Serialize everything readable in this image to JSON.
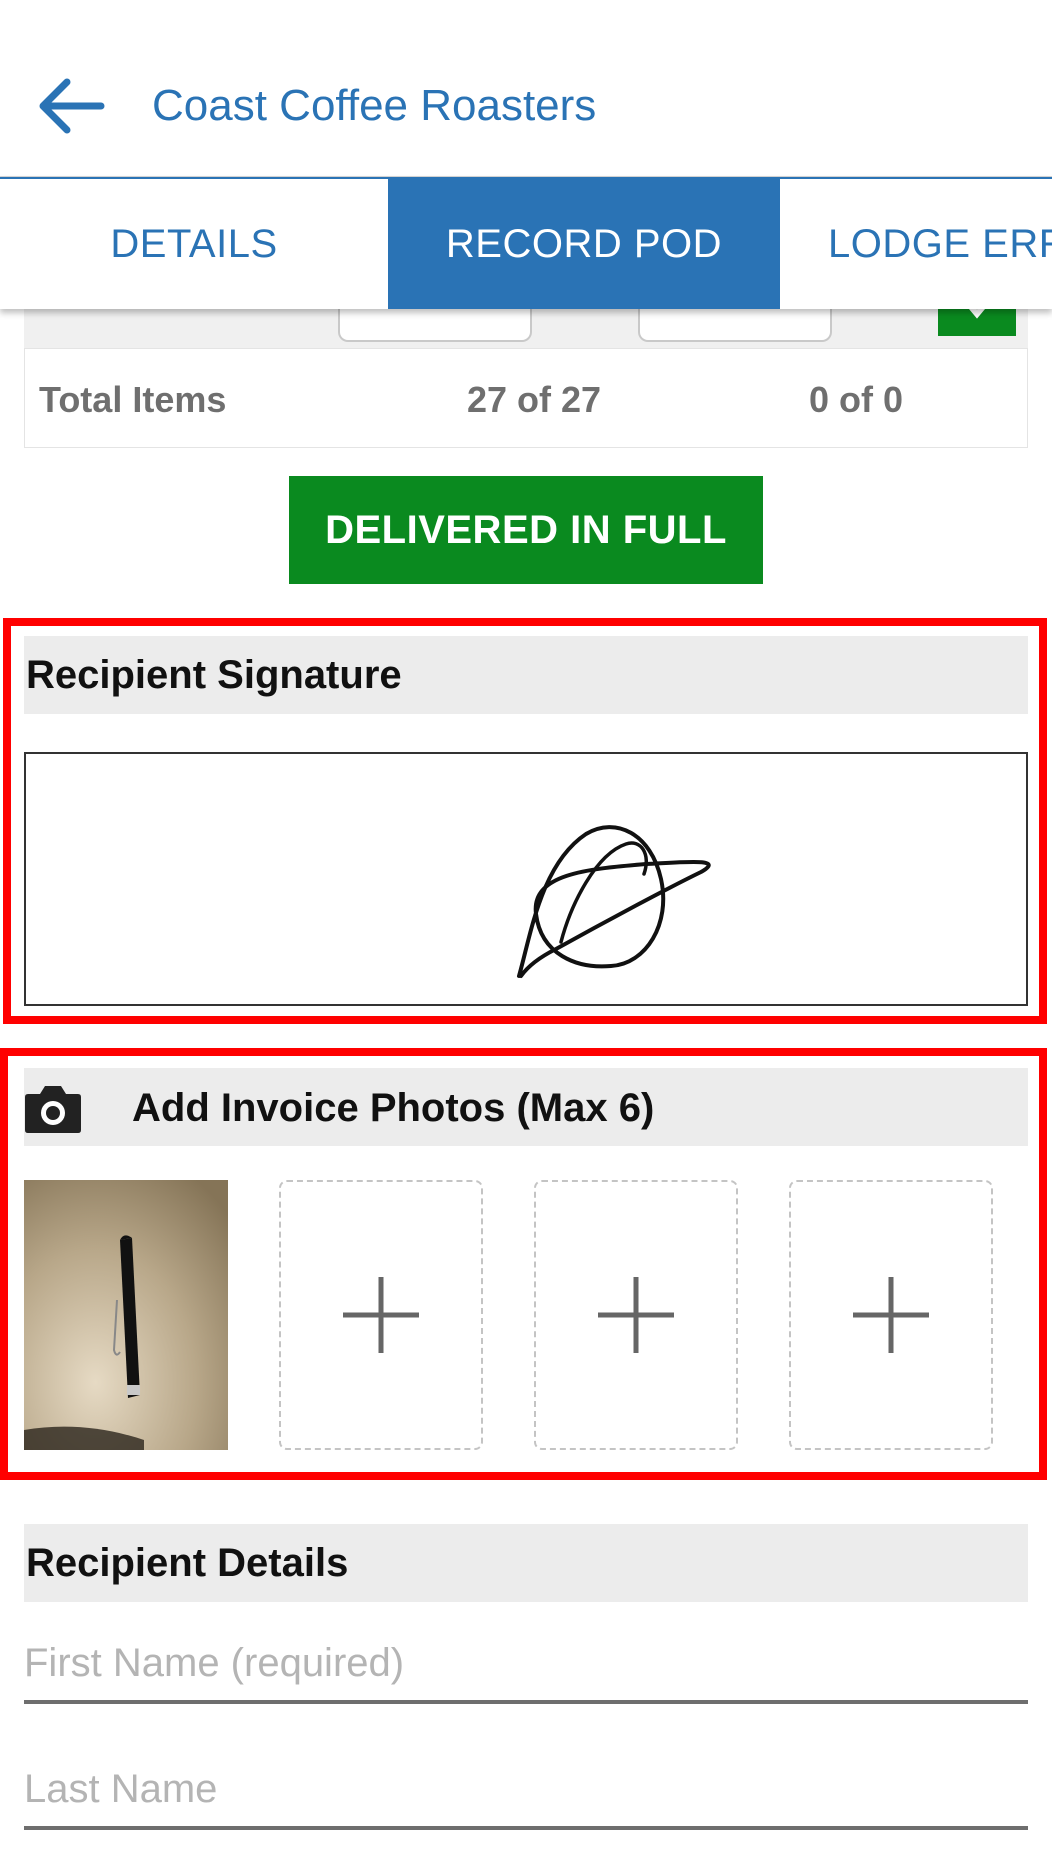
{
  "header": {
    "title": "Coast Coffee Roasters"
  },
  "tabs": [
    {
      "label": "DETAILS"
    },
    {
      "label": "RECORD POD"
    },
    {
      "label": "LODGE ERR"
    }
  ],
  "totals": {
    "label": "Total Items",
    "value_1": "27 of 27",
    "value_2": "0 of 0"
  },
  "delivered_button": "DELIVERED IN FULL",
  "signature_section": {
    "title": "Recipient Signature"
  },
  "photos_section": {
    "title": "Add Invoice Photos (Max 6)",
    "icon": "camera-icon",
    "empty_slots": 3
  },
  "recipient_details": {
    "title": "Recipient Details",
    "first_name_placeholder": "First Name (required)",
    "last_name_placeholder": "Last Name"
  },
  "colors": {
    "accent_blue": "#2a73b5",
    "success_green": "#0a8a1f",
    "highlight_red": "#ff0000"
  }
}
